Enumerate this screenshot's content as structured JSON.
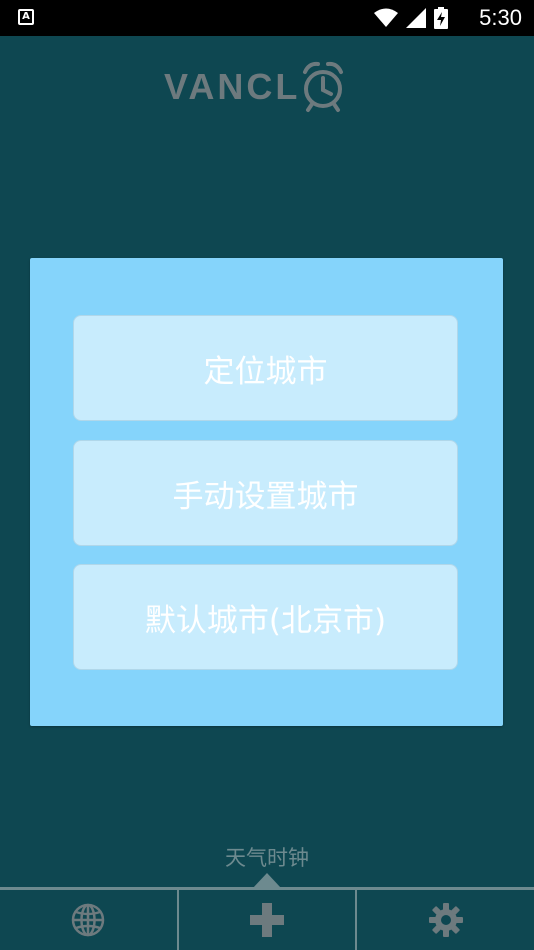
{
  "status_bar": {
    "time": "5:30",
    "notification_icon": "A",
    "icons": [
      "wifi-icon",
      "signal-icon",
      "battery-charging-icon"
    ]
  },
  "logo": {
    "text": "VANCL",
    "icon": "alarm-clock-icon"
  },
  "dialog": {
    "options": [
      {
        "label": "定位城市"
      },
      {
        "label": "手动设置城市"
      },
      {
        "label": "默认城市(北京市)"
      }
    ]
  },
  "bottom": {
    "label": "天气时钟",
    "nav": [
      "globe-icon",
      "plus-icon",
      "gear-icon"
    ]
  },
  "colors": {
    "background": "#0e4751",
    "dialog": "#85d4fb",
    "button": "#c8ecfd",
    "muted": "#6d8a8f"
  }
}
